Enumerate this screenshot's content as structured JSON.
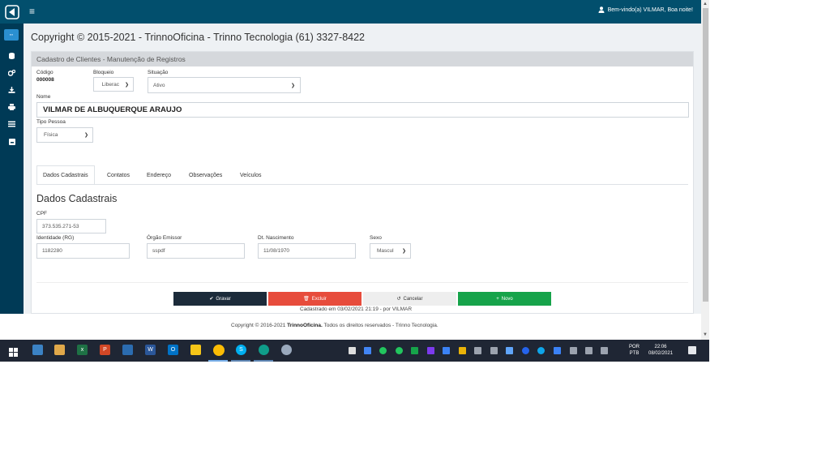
{
  "navbar": {
    "menu_icon": "hamburger-icon",
    "user_icon": "user-icon",
    "welcome": "Bem-vindo(a) VILMAR, Boa noite!"
  },
  "sidebar": {
    "icons": [
      "database-icon",
      "cogs-icon",
      "download-icon",
      "print-icon",
      "list-icon",
      "report-icon"
    ]
  },
  "page": {
    "title": "Copyright © 2015-2021 - TrinnoOficina - Trinno Tecnologia (61) 3327-8422",
    "panel_title": "Cadastro de Clientes - Manutenção de Registros"
  },
  "form": {
    "codigo_label": "Código",
    "codigo_value": "000008",
    "bloqueio_label": "Bloqueio",
    "bloqueio_value": "Liberac",
    "situacao_label": "Situação",
    "situacao_value": "Ativo",
    "nome_label": "Nome",
    "nome_value": "VILMAR DE ALBUQUERQUE ARAUJO",
    "tipo_label": "Tipo Pessoa",
    "tipo_value": "Física"
  },
  "tabs": [
    {
      "label": "Dados Cadastrais",
      "active": true
    },
    {
      "label": "Contatos",
      "active": false
    },
    {
      "label": "Endereço",
      "active": false
    },
    {
      "label": "Observações",
      "active": false
    },
    {
      "label": "Veículos",
      "active": false
    }
  ],
  "section": {
    "title": "Dados Cadastrais",
    "cpf_label": "CPF",
    "cpf_value": "373.535.271-53",
    "rg_label": "Identidade (RG)",
    "rg_value": "1182280",
    "orgao_label": "Órgão Emissor",
    "orgao_value": "sspdf",
    "nasc_label": "Dt. Nascimento",
    "nasc_value": "11/08/1970",
    "sexo_label": "Sexo",
    "sexo_value": "Mascul"
  },
  "buttons": {
    "gravar": "Gravar",
    "excluir": "Excluir",
    "cancelar": "Cancelar",
    "novo": "Novo",
    "colors": {
      "gravar": "#1c2b3a",
      "excluir": "#e74c3c",
      "cancelar": "#eeeeee",
      "novo": "#16a34a"
    }
  },
  "cadastrado": "Cadastrado em 03/02/2021 21:19 - por VILMAR",
  "footer": {
    "prefix": "Copyright © 2016-2021 ",
    "brand": "TrinnoOficina.",
    "suffix": " Todos os direitos reservados - Trinno Tecnologia."
  },
  "taskbar": {
    "lang_line1": "POR",
    "lang_line2": "PTB",
    "time": "22:06",
    "date": "08/02/2021"
  },
  "colors": {
    "navbar": "#024f6d",
    "sidebar": "#003a56",
    "taskbar": "#1f2634"
  }
}
